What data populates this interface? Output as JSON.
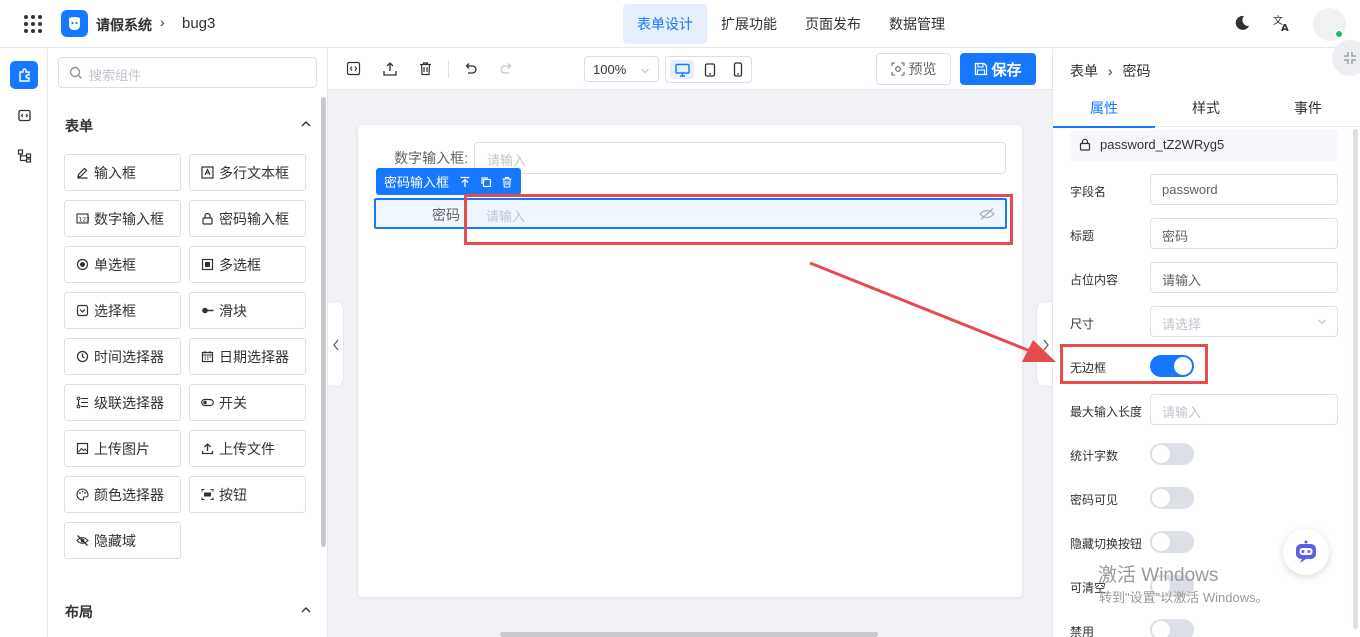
{
  "header": {
    "app_name": "请假系统",
    "breadcrumb_sep": "›",
    "project": "bug3",
    "nav": [
      {
        "label": "表单设计",
        "active": true
      },
      {
        "label": "扩展功能",
        "active": false
      },
      {
        "label": "页面发布",
        "active": false
      },
      {
        "label": "数据管理",
        "active": false
      }
    ],
    "icons": [
      "grid-menu-icon",
      "logo-icon",
      "moon-icon",
      "translate-icon",
      "avatar"
    ]
  },
  "palette": {
    "search_placeholder": "搜索组件",
    "section_form": "表单",
    "section_layout": "布局",
    "components": [
      {
        "label": "输入框",
        "icon": "pencil-icon"
      },
      {
        "label": "多行文本框",
        "icon": "textarea-icon"
      },
      {
        "label": "数字输入框",
        "icon": "number-icon"
      },
      {
        "label": "密码输入框",
        "icon": "lock-icon"
      },
      {
        "label": "单选框",
        "icon": "radio-icon"
      },
      {
        "label": "多选框",
        "icon": "checkbox-icon"
      },
      {
        "label": "选择框",
        "icon": "select-icon"
      },
      {
        "label": "滑块",
        "icon": "slider-icon"
      },
      {
        "label": "时间选择器",
        "icon": "clock-icon"
      },
      {
        "label": "日期选择器",
        "icon": "calendar-icon"
      },
      {
        "label": "级联选择器",
        "icon": "cascader-icon"
      },
      {
        "label": "开关",
        "icon": "toggle-icon"
      },
      {
        "label": "上传图片",
        "icon": "image-icon"
      },
      {
        "label": "上传文件",
        "icon": "upload-icon"
      },
      {
        "label": "颜色选择器",
        "icon": "palette-icon"
      },
      {
        "label": "按钮",
        "icon": "button-icon"
      },
      {
        "label": "隐藏域",
        "icon": "eye-off-icon"
      }
    ]
  },
  "toolbar": {
    "zoom": "100%",
    "preview": "预览",
    "save": "保存"
  },
  "canvas": {
    "fields": [
      {
        "label": "数字输入框:",
        "placeholder": "请输入"
      },
      {
        "label": "密码",
        "placeholder": "请输入"
      }
    ],
    "selected_tag": "密码输入框"
  },
  "properties": {
    "breadcrumb": [
      "表单",
      "密码"
    ],
    "tabs": [
      {
        "label": "属性",
        "active": true
      },
      {
        "label": "样式",
        "active": false
      },
      {
        "label": "事件",
        "active": false
      }
    ],
    "component_id": "password_tZ2WRyg5",
    "rows": [
      {
        "label": "字段名",
        "type": "input",
        "value": "password"
      },
      {
        "label": "标题",
        "type": "input",
        "value": "密码"
      },
      {
        "label": "占位内容",
        "type": "input",
        "value": "请输入"
      },
      {
        "label": "尺寸",
        "type": "select",
        "placeholder": "请选择"
      },
      {
        "label": "无边框",
        "type": "switch",
        "on": true
      },
      {
        "label": "最大输入长度",
        "type": "input",
        "placeholder": "请输入"
      },
      {
        "label": "统计字数",
        "type": "switch",
        "on": false
      },
      {
        "label": "密码可见",
        "type": "switch",
        "on": false
      },
      {
        "label": "隐藏切换按钮",
        "type": "switch",
        "on": false
      },
      {
        "label": "可清空",
        "type": "switch",
        "on": false
      },
      {
        "label": "禁用",
        "type": "switch",
        "on": false
      }
    ]
  },
  "watermark": {
    "line1": "激活 Windows",
    "line2": "转到\"设置\"以激活 Windows。"
  },
  "colors": {
    "accent": "#1677ff",
    "annotation": "#e74c4c"
  }
}
